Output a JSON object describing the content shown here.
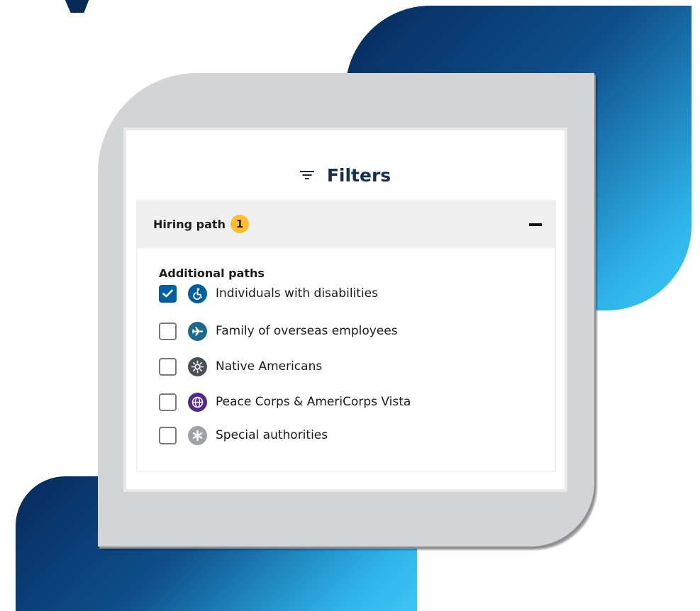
{
  "heading_letter": "y",
  "filters": {
    "title": "Filters",
    "icon": "filter-lines-icon"
  },
  "hiring_path": {
    "label": "Hiring path",
    "selected_count": "1",
    "expanded": true,
    "group_title": "Additional paths",
    "options": [
      {
        "label": "Individuals with disabilities",
        "checked": true,
        "icon": "accessibility-icon",
        "icon_color": "#005ea2"
      },
      {
        "label": "Family of overseas employees",
        "checked": false,
        "icon": "airplane-icon",
        "icon_color": "#1a6a8e"
      },
      {
        "label": "Native Americans",
        "checked": false,
        "icon": "sun-icon",
        "icon_color": "#4a4f57"
      },
      {
        "label": "Peace Corps & AmeriCorps Vista",
        "checked": false,
        "icon": "globe-icon",
        "icon_color": "#54278f"
      },
      {
        "label": "Special authorities",
        "checked": false,
        "icon": "asterisk-icon",
        "icon_color": "#9ea2a8"
      }
    ]
  },
  "colors": {
    "accent": "#005ea2",
    "badge": "#ffbe2e",
    "brand_dark": "#062a5c",
    "brand_light": "#3cc6f5"
  }
}
